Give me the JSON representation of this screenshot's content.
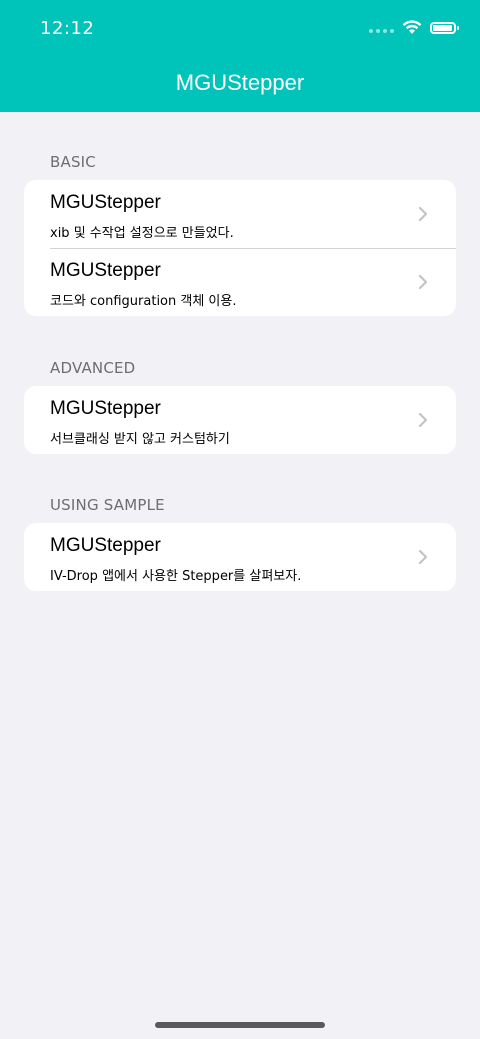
{
  "status_bar": {
    "time": "12:12",
    "battery_level": 0.95
  },
  "navbar": {
    "title": "MGUStepper",
    "background": "#00c3b9"
  },
  "sections": [
    {
      "header": "BASIC",
      "rows": [
        {
          "title": "MGUStepper",
          "subtitle": "xib 및 수작업 설정으로 만들었다."
        },
        {
          "title": "MGUStepper",
          "subtitle": "코드와 configuration 객체 이용."
        }
      ]
    },
    {
      "header": "ADVANCED",
      "rows": [
        {
          "title": "MGUStepper",
          "subtitle": "서브클래싱 받지 않고 커스텀하기"
        }
      ]
    },
    {
      "header": "USING SAMPLE",
      "rows": [
        {
          "title": "MGUStepper",
          "subtitle": "IV-Drop 앱에서 사용한 Stepper를 살펴보자."
        }
      ]
    }
  ]
}
